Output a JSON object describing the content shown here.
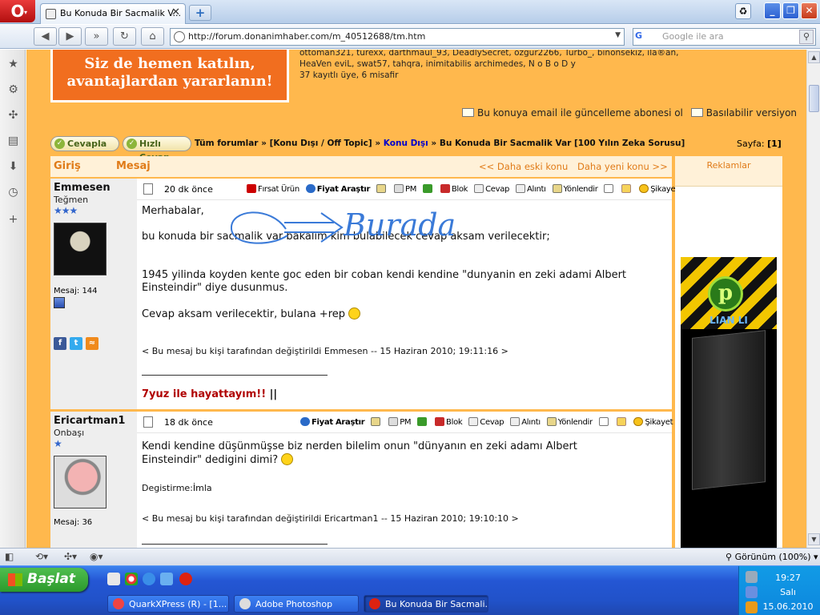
{
  "browser": {
    "tab_title": "Bu Konuda Bir Sacmalik V...",
    "tab_close": "✕",
    "new_tab": "+",
    "opera_logo": "O",
    "url": "http://forum.donanimhaber.com/m_40512688/tm.htm",
    "search_placeholder": "Google ile ara",
    "search_engine": "G"
  },
  "banner": {
    "line1": "Siz de hemen katılın,",
    "line2": "avantajlardan yararlanın!"
  },
  "online": {
    "line1": "ottoman321, turexx, darthmaul_93, DeadlySecret, ozgur2266, Turbo_, binonsekiz, ila®an,",
    "line2": "HeaVen eviL, swat57, tahqra, inimitabilis archimedes, N o B o D y",
    "line3": "37 kayıtlı üye, 6 misafir"
  },
  "subscribe_text": "Bu konuya email ile güncelleme abonesi ol",
  "print_text": "Basılabilir versiyon",
  "actions": {
    "reply": "Cevapla",
    "quick_reply": "Hızlı Cevap",
    "bc_all": "Tüm forumlar",
    "bc_sep": "»",
    "bc_offtopic": "[Konu Dışı / Off Topic]",
    "bc_kd": "Konu Dışı",
    "bc_thread": "Bu Konuda Bir Sacmalik Var [100 Yılın Zeka Sorusu]",
    "page_label": "Sayfa:",
    "page_value": "[1]"
  },
  "table": {
    "col_login": "Giriş",
    "col_message": "Mesaj",
    "older": "<< Daha eski konu",
    "newer": "Daha yeni konu >>"
  },
  "toolbar": {
    "firsat": "Fırsat Ürün",
    "fiyat": "Fiyat Araştır",
    "pm": "PM",
    "blok": "Blok",
    "cevap": "Cevap",
    "alinti": "Alıntı",
    "yonlendir": "Yönlendir",
    "sikayet": "Şikayet Et"
  },
  "posts": [
    {
      "author": "Emmesen",
      "rank": "Teğmen",
      "stars": "★★★",
      "msg_count": "Mesaj: 144",
      "time_ago": "20 dk önce",
      "line1": "Merhabalar,",
      "line2": "bu konuda bir sacmalik var bakalim kim bulabilecek cevap aksam verilecektir;",
      "line3": "1945 yilinda koyden kente goc eden bir coban kendi kendine \"dunyanin en zeki adami Albert Einsteindir\" diye dusunmus.",
      "line4": "Cevap aksam verilecektir, bulana +rep",
      "edit_note": "< Bu mesaj bu kişi tarafından değiştirildi Emmesen -- 15 Haziran 2010; 19:11:16 >",
      "signature": "7yuz ile hayattayım!!",
      "sig_bars": "||"
    },
    {
      "author": "Ericartman1",
      "rank": "Onbaşı",
      "stars": "★",
      "msg_count": "Mesaj: 36",
      "time_ago": "18 dk önce",
      "line1": "Kendi kendine düşünmüşse biz nerden bilelim onun \"dünyanın en zeki adamı Albert Einsteindir\" dedigini dimi?",
      "line2": "Degistirme:İmla",
      "edit_note": "< Bu mesaj bu kişi tarafından değiştirildi Ericartman1 -- 15 Haziran 2010; 19:10:10 >"
    }
  ],
  "annotation": "Burada",
  "ad": {
    "header": "Reklamlar",
    "brand": "LIAN LI",
    "logo": "p"
  },
  "status": {
    "zoom": "Görünüm (100%)"
  },
  "taskbar": {
    "start": "Başlat",
    "tasks": [
      "QuarkXPress (R) - [1...",
      "Adobe Photoshop",
      "Bu Konuda Bir Sacmali..."
    ],
    "time": "19:27",
    "day": "Salı",
    "date": "15.06.2010"
  }
}
